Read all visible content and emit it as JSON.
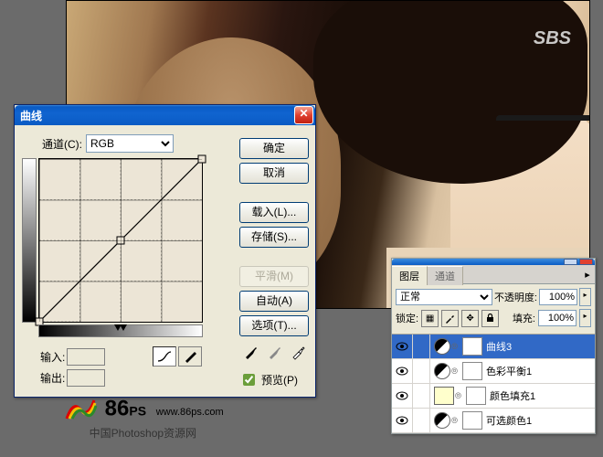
{
  "canvas": {
    "watermark_logo": "SBS"
  },
  "curves_dialog": {
    "title": "曲线",
    "channel_label": "通道(C):",
    "channel_value": "RGB",
    "buttons": {
      "ok": "确定",
      "cancel": "取消",
      "load": "载入(L)...",
      "save": "存储(S)...",
      "smooth": "平滑(M)",
      "auto": "自动(A)",
      "options": "选项(T)..."
    },
    "input_label": "输入:",
    "output_label": "输出:",
    "preview_label": "预览(P)",
    "preview_checked": true
  },
  "watermark": {
    "big": "86",
    "suffix": "PS",
    "url": "www.86ps.com",
    "caption": "中国Photoshop资源网"
  },
  "layers_palette": {
    "tab_layers": "图层",
    "tab_channels": "通道",
    "blend_mode": "正常",
    "opacity_label": "不透明度:",
    "opacity_value": "100%",
    "lock_label": "锁定:",
    "fill_label": "填充:",
    "fill_value": "100%",
    "layers": [
      {
        "name": "曲线3",
        "selected": true,
        "type": "adj",
        "mask": true
      },
      {
        "name": "色彩平衡1",
        "selected": false,
        "type": "adj",
        "mask": true
      },
      {
        "name": "颜色填充1",
        "selected": false,
        "type": "fill",
        "mask": true,
        "swatch": "fill-yellow"
      },
      {
        "name": "可选颜色1",
        "selected": false,
        "type": "adj",
        "mask": true
      }
    ]
  },
  "chart_data": {
    "type": "line",
    "title": "曲线 (Curves)",
    "xlabel": "输入",
    "ylabel": "输出",
    "xlim": [
      0,
      255
    ],
    "ylim": [
      0,
      255
    ],
    "series": [
      {
        "name": "RGB",
        "x": [
          0,
          128,
          255
        ],
        "y": [
          0,
          128,
          255
        ]
      }
    ]
  }
}
